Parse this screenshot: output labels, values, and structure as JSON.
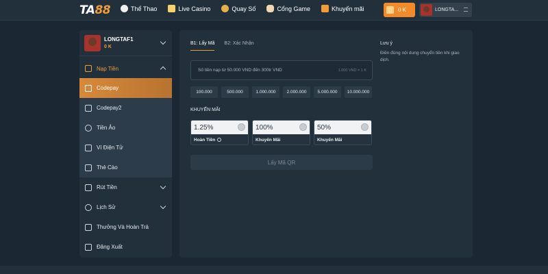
{
  "brand": {
    "logo_ta": "TA",
    "logo_88": "88"
  },
  "nav": [
    {
      "label": "Thể Thao",
      "icon": "soccer-icon",
      "color": "#f0f0f0"
    },
    {
      "label": "Live Casino",
      "icon": "card-icon",
      "color": "#f5d26b"
    },
    {
      "label": "Quay Số",
      "icon": "lottery-icon",
      "color": "#e8b04a"
    },
    {
      "label": "Cổng Game",
      "icon": "gamepad-icon",
      "color": "#f0d9b0"
    },
    {
      "label": "Khuyến mãi",
      "icon": "gift-icon",
      "color": "#f29c38"
    }
  ],
  "header": {
    "balance": "0 K",
    "username": "LONGTA..."
  },
  "sidebar": {
    "profile_name": "LONGTAF1",
    "profile_balance": "0 K",
    "deposit_label": "Nạp Tiền",
    "deposit_items": [
      {
        "label": "Codepay",
        "icon": "codepay-icon"
      },
      {
        "label": "Codepay2",
        "icon": "bank-icon"
      },
      {
        "label": "Tiền Ảo",
        "icon": "crypto-icon"
      },
      {
        "label": "Ví Điện Tử",
        "icon": "ewallet-icon"
      },
      {
        "label": "Thẻ Cào",
        "icon": "card-scratch-icon"
      }
    ],
    "other_items": [
      {
        "label": "Rút Tiền",
        "icon": "withdraw-icon"
      },
      {
        "label": "Lịch Sử",
        "icon": "history-icon"
      },
      {
        "label": "Thưởng Và Hoàn Trả",
        "icon": "reward-icon"
      },
      {
        "label": "Đăng Xuất",
        "icon": "logout-icon"
      }
    ]
  },
  "main": {
    "tab1": "B1: Lấy Mã",
    "tab2": "B2: Xác Nhận",
    "amount_placeholder": "Số tiền nạp từ 50.000 VND đến 300tr VND",
    "rate": "1.000 VND = 1 K",
    "chips": [
      "100.000",
      "500.000",
      "1.000.000",
      "2.000.000",
      "5.000.000",
      "10.000.000"
    ],
    "promo_title": "KHUYẾN MÃI",
    "promos": [
      {
        "value": "1.25%",
        "label": "Hoàn Tiền"
      },
      {
        "value": "100%",
        "label": "Khuyến Mãi"
      },
      {
        "value": "50%",
        "label": "Khuyến Mãi"
      }
    ],
    "qr_button": "Lấy Mã QR",
    "note_title": "Lưu ý",
    "note_body": "Điền đúng nội dung chuyển tiền khi giao dịch."
  }
}
